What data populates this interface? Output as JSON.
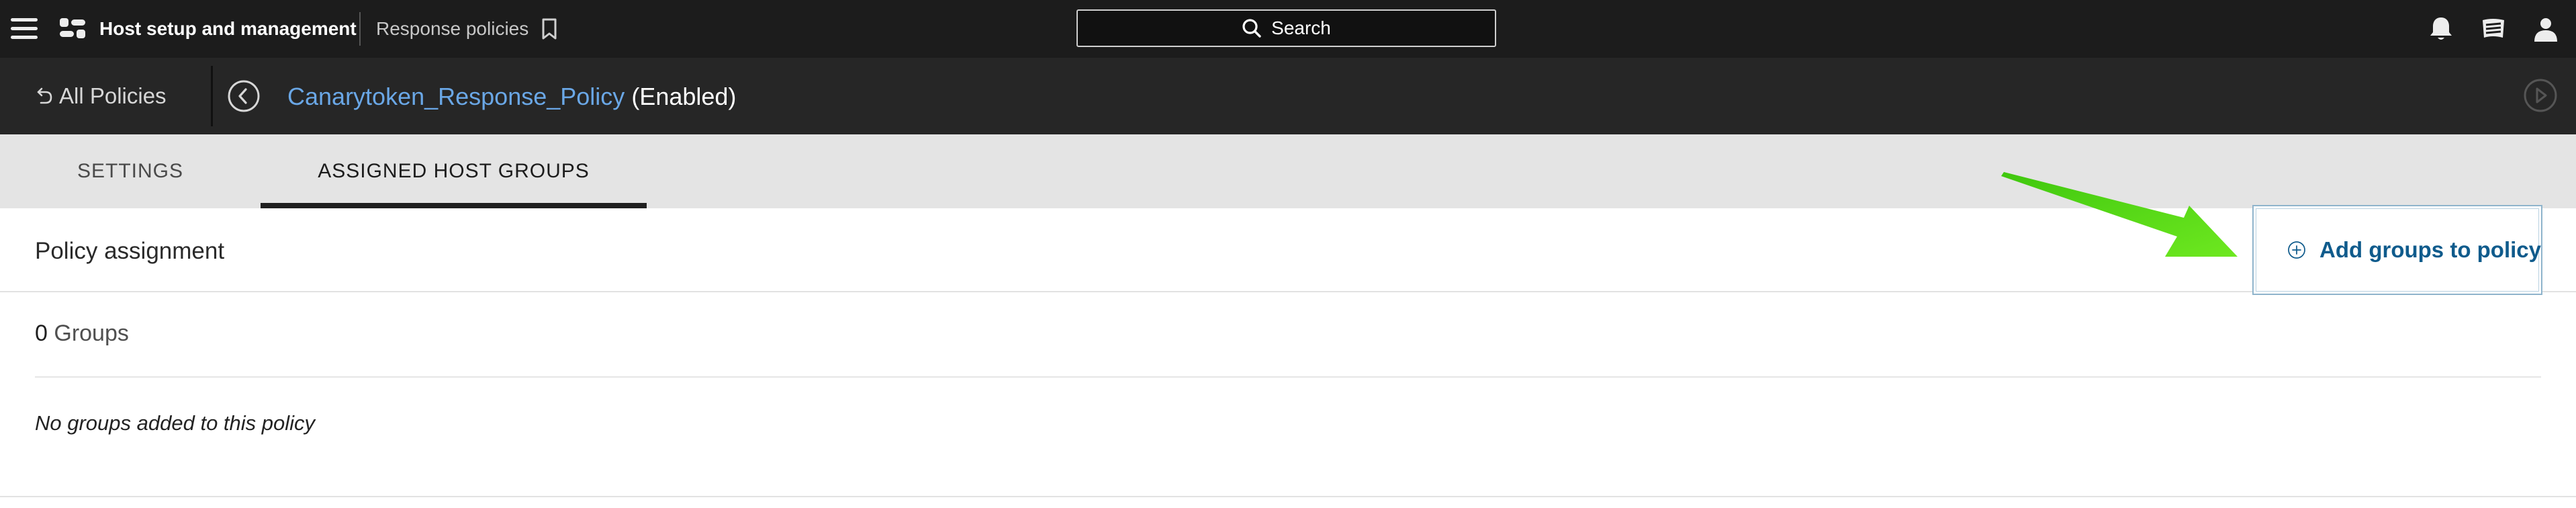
{
  "topbar": {
    "app_title": "Host setup and management",
    "breadcrumb": "Response policies",
    "search_label": "Search",
    "icons": [
      "menu-icon",
      "app-logo-icon",
      "bookmark-icon",
      "search-icon",
      "bell-icon",
      "news-icon",
      "user-icon"
    ]
  },
  "policy_header": {
    "back_label": "All Policies",
    "policy_name": "Canarytoken_Response_Policy",
    "policy_status": "(Enabled)"
  },
  "tabs": [
    {
      "label": "SETTINGS",
      "active": false
    },
    {
      "label": "ASSIGNED HOST GROUPS",
      "active": true
    }
  ],
  "assignment": {
    "section_title": "Policy assignment",
    "add_button_label": "Add groups to policy",
    "group_count": "0",
    "group_count_label": "Groups",
    "empty_message": "No groups added to this policy"
  },
  "colors": {
    "topbar_bg": "#1c1c1c",
    "policybar_bg": "#262626",
    "tabs_bg": "#e4e4e4",
    "link_blue": "#6aa7e6",
    "button_blue": "#0f5b8c",
    "annotation_green": "#5fdc1c"
  }
}
